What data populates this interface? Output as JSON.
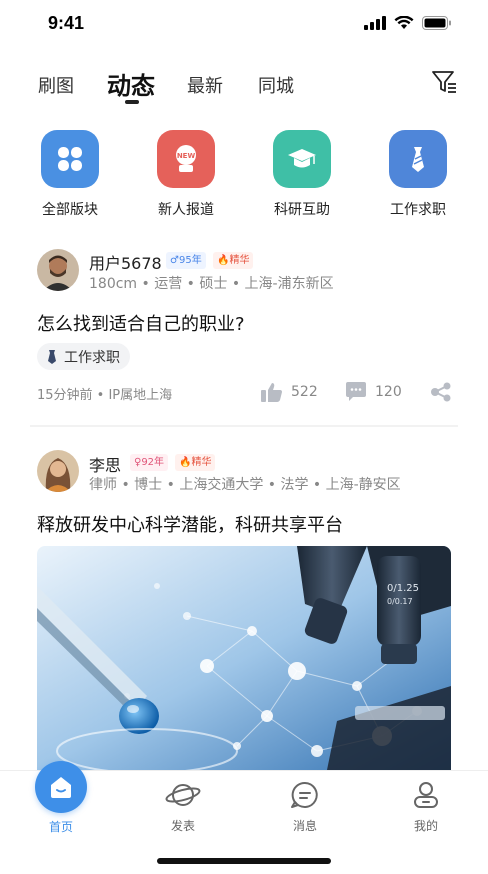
{
  "status_bar": {
    "time": "9:41"
  },
  "tabs": [
    {
      "label": "刷图"
    },
    {
      "label": "动态"
    },
    {
      "label": "最新"
    },
    {
      "label": "同城"
    }
  ],
  "categories": [
    {
      "label": "全部版块",
      "icon": "four-petals-icon",
      "color": "#4a90e2"
    },
    {
      "label": "新人报道",
      "icon": "new-badge-icon",
      "color": "#e5615a"
    },
    {
      "label": "科研互助",
      "icon": "graduation-cap-icon",
      "color": "#3fbfa6"
    },
    {
      "label": "工作求职",
      "icon": "tie-icon",
      "color": "#4f86d9"
    }
  ],
  "posts": [
    {
      "user": "用户5678",
      "gender_badge": "♂95年",
      "hot_badge": "精华",
      "meta": "180cm • 运营 • 硕士 • 上海-浦东新区",
      "title": "怎么找到适合自己的职业?",
      "tag": "工作求职",
      "time": "15分钟前 • IP属地上海",
      "likes": "522",
      "comments": "120"
    },
    {
      "user": "李思",
      "gender_badge": "♀92年",
      "hot_badge": "精华",
      "meta": "律师 • 博士 • 上海交通大学 • 法学 • 上海-静安区",
      "title": "释放研发中心科学潜能，科研共享平台"
    }
  ],
  "bottom_nav": [
    {
      "label": "首页",
      "icon": "home-icon"
    },
    {
      "label": "发表",
      "icon": "planet-icon"
    },
    {
      "label": "消息",
      "icon": "message-icon"
    },
    {
      "label": "我的",
      "icon": "profile-icon"
    }
  ],
  "colors": {
    "accent": "#3e8fe8",
    "hot": "#e5533f"
  }
}
